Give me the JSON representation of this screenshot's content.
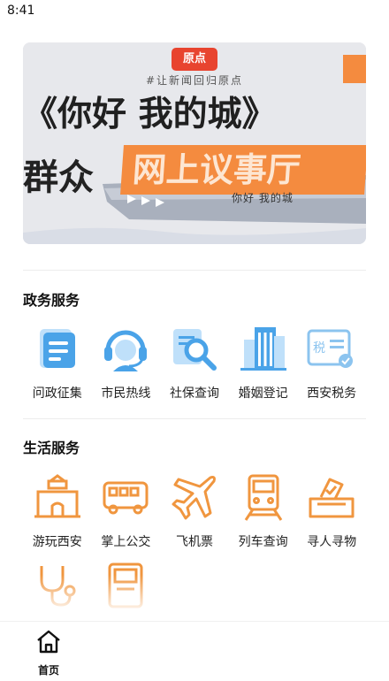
{
  "status_bar": {
    "time": "8:41"
  },
  "banner": {
    "logo_text": "原点",
    "slogan": "#让新闻回归原点",
    "title": "《你好 我的城》",
    "left_text": "群众",
    "hall_text": "网上议事厅",
    "ship_text": "你好 我的城"
  },
  "sections": [
    {
      "title": "政务服务",
      "items": [
        {
          "label": "问政征集",
          "icon": "form-collection-icon"
        },
        {
          "label": "市民热线",
          "icon": "hotline-headset-icon"
        },
        {
          "label": "社保查询",
          "icon": "document-search-icon"
        },
        {
          "label": "婚姻登记",
          "icon": "building-icon"
        },
        {
          "label": "西安税务",
          "icon": "tax-document-icon"
        }
      ]
    },
    {
      "title": "生活服务",
      "items": [
        {
          "label": "游玩西安",
          "icon": "city-gate-icon"
        },
        {
          "label": "掌上公交",
          "icon": "bus-icon"
        },
        {
          "label": "飞机票",
          "icon": "airplane-icon"
        },
        {
          "label": "列车查询",
          "icon": "train-icon"
        },
        {
          "label": "寻人寻物",
          "icon": "ballot-box-icon"
        }
      ]
    }
  ],
  "partial_row_icons": [
    "stethoscope-icon",
    "atm-machine-icon"
  ],
  "tabbar": {
    "home_label": "首页",
    "home_icon": "home-icon"
  },
  "colors": {
    "blue_icon": "#4aa3e8",
    "orange_icon": "#f0963f",
    "banner_orange": "#f48b3f"
  }
}
